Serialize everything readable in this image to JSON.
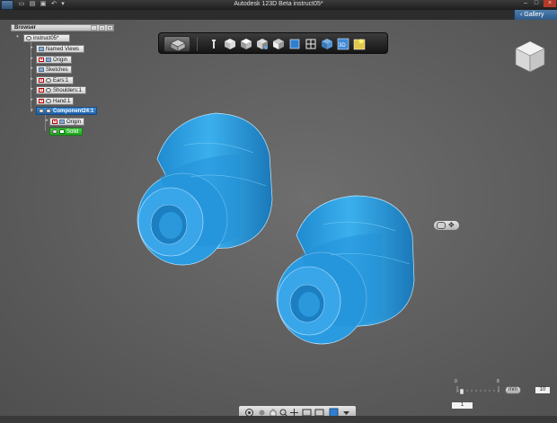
{
  "window": {
    "title": "Autodesk 123D Beta   instruct05*",
    "gallery_label": "Gallery"
  },
  "browser": {
    "title": "Browser",
    "tree": [
      {
        "label": "instruct05*",
        "icon": "document-icon"
      },
      {
        "label": "Named Views",
        "icon": "folder-icon"
      },
      {
        "label": "Origin",
        "icon": "hidden-icon"
      },
      {
        "label": "Sketches",
        "icon": "folder-icon"
      },
      {
        "label": "Ears:1",
        "icon": "hidden-icon"
      },
      {
        "label": "Shoulders:1",
        "icon": "hidden-icon"
      },
      {
        "label": "Hand:1",
        "icon": "hidden-icon"
      },
      {
        "label": "Component24:1",
        "icon": "component-icon"
      },
      {
        "label": "Origin",
        "icon": "hidden-icon"
      },
      {
        "label": "Solid",
        "icon": "solid-icon"
      }
    ]
  },
  "toolbar": {
    "buttons": [
      "home-view",
      "look-at",
      "front-view",
      "top-view",
      "iso-view",
      "right-view",
      "shaded",
      "wireframe",
      "visual-style",
      "grid",
      "snap"
    ]
  },
  "scale": {
    "tick_left": "0",
    "tick_right": "8",
    "unit": "mm",
    "value": "10",
    "step": "1"
  },
  "colors": {
    "part_fill": "#2a9be0",
    "part_edge": "#bfe6ff",
    "selection": "#1d5fa8",
    "solid_highlight": "#1ea31e"
  }
}
